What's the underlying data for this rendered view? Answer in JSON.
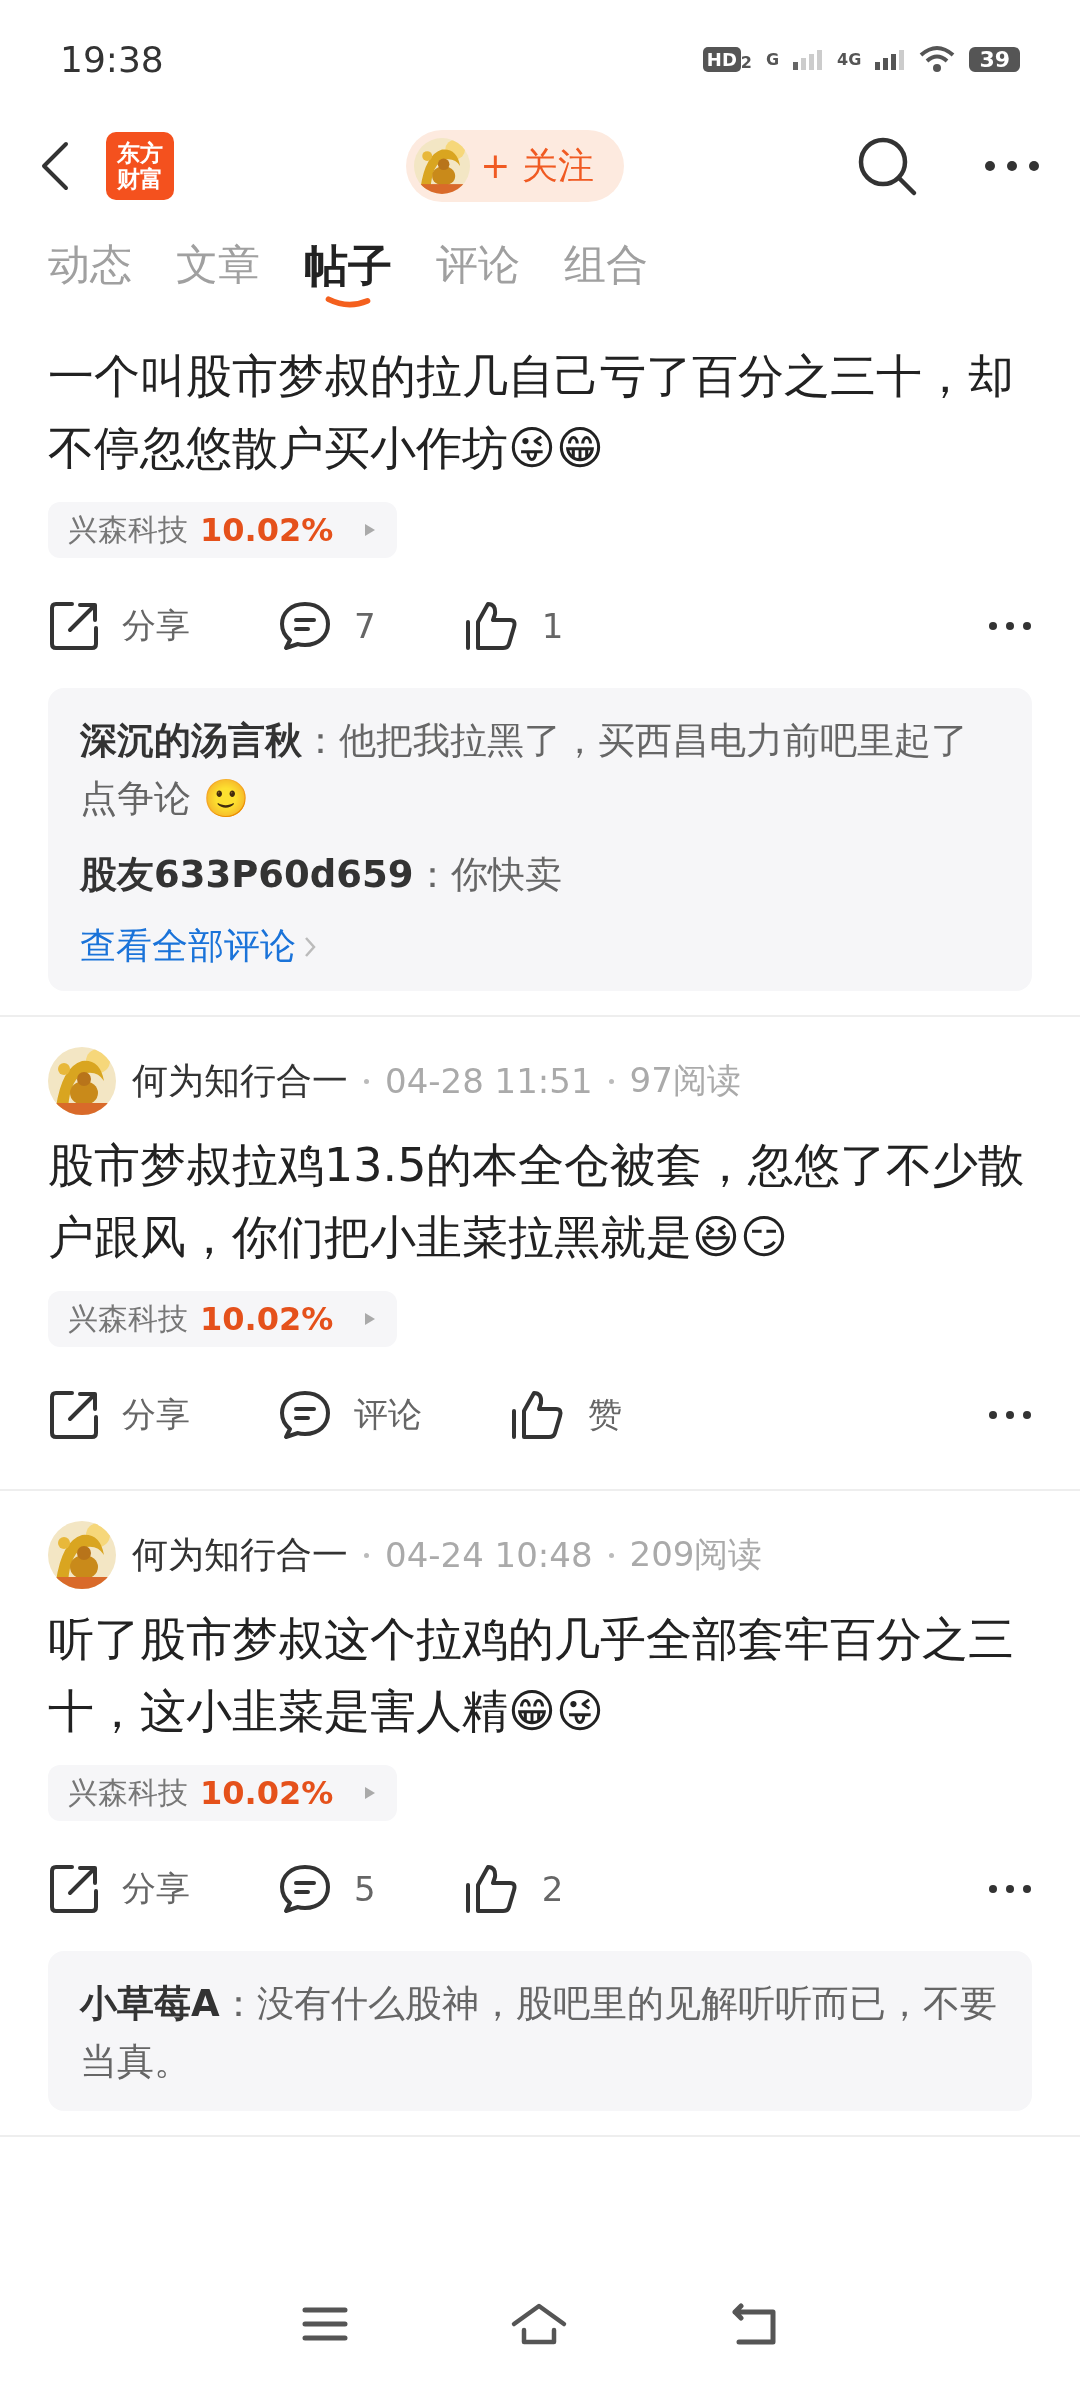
{
  "status_bar": {
    "time": "19:38",
    "hd": "HD",
    "hd_sub": "2",
    "sim1": "G",
    "sim2": "4G",
    "battery": "39"
  },
  "header": {
    "logo_lines": [
      "东方",
      "财富"
    ],
    "follow": "+ 关注"
  },
  "tabs": [
    {
      "label": "动态",
      "selected": false
    },
    {
      "label": "文章",
      "selected": false
    },
    {
      "label": "帖子",
      "selected": true
    },
    {
      "label": "评论",
      "selected": false
    },
    {
      "label": "组合",
      "selected": false
    }
  ],
  "posts": [
    {
      "body": "一个叫股市梦叔的拉几自己亏了百分之三十，却不停忽悠散户买小作坊😜😁",
      "stock": {
        "name": "兴森科技",
        "change": "10.02%"
      },
      "share": "分享",
      "comment": "7",
      "like": "1",
      "comments": [
        {
          "text": "**深沉的汤言秋**：他把我拉黑了，买西昌电力前吧里起了点争论 🙂"
        },
        {
          "text": "**股友633P60d659**：你快卖"
        }
      ],
      "more_comments": "查看全部评论"
    },
    {
      "author": "何为知行合一",
      "time": "04-28 11:51",
      "reads": "97阅读",
      "body": "股市梦叔拉鸡13.5的本全仓被套，忽悠了不少散户跟风，你们把小韭菜拉黑就是😆😏",
      "stock": {
        "name": "兴森科技",
        "change": "10.02%"
      },
      "share": "分享",
      "comment": "评论",
      "like": "赞"
    },
    {
      "author": "何为知行合一",
      "time": "04-24 10:48",
      "reads": "209阅读",
      "body": "听了股市梦叔这个拉鸡的几乎全部套牢百分之三十，这小韭菜是害人精😁😜",
      "stock": {
        "name": "兴森科技",
        "change": "10.02%"
      },
      "share": "分享",
      "comment": "5",
      "like": "2",
      "comments": [
        {
          "text": "**小草莓A**：没有什么股神，股吧里的见解听听而已，不要当真。"
        }
      ]
    }
  ]
}
